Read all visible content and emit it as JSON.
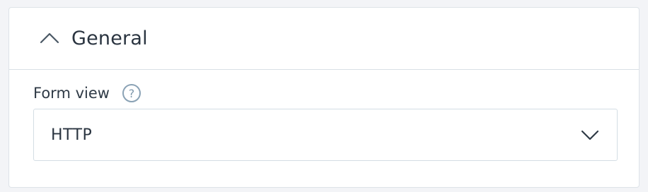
{
  "section": {
    "title": "General",
    "expanded": true,
    "toggle_icon": "chevron-up-icon"
  },
  "form_view": {
    "label": "Form view",
    "help_icon": "help-icon",
    "help_glyph": "?",
    "selected_value": "HTTP",
    "dropdown_icon": "chevron-down-icon"
  },
  "colors": {
    "text": "#2a3440",
    "border": "#d4dde4",
    "help": "#8aa2b5",
    "background": "#f3f4f7"
  }
}
